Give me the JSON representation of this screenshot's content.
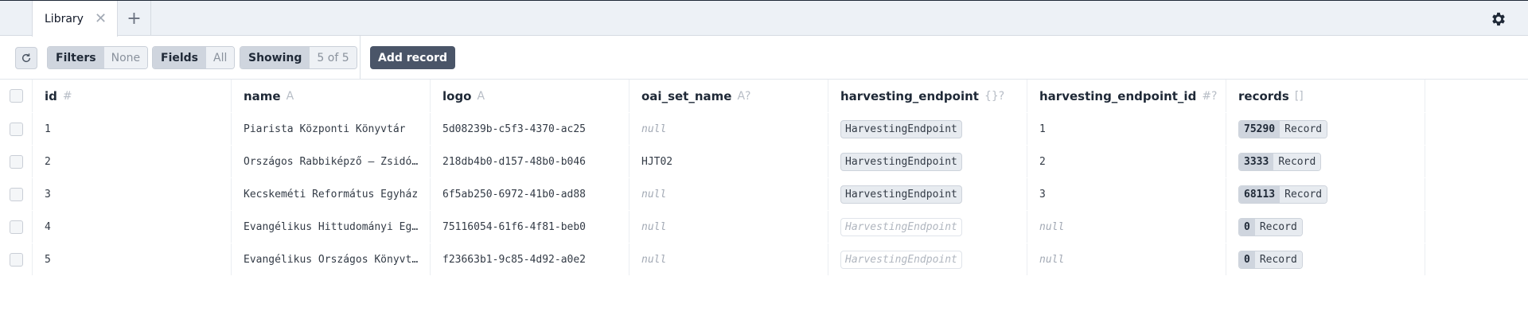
{
  "tabs": [
    {
      "label": "Library"
    }
  ],
  "toolbar": {
    "filters": {
      "label": "Filters",
      "value": "None"
    },
    "fields": {
      "label": "Fields",
      "value": "All"
    },
    "showing": {
      "label": "Showing",
      "value": "5 of 5"
    },
    "add_record": "Add record"
  },
  "table": {
    "columns": [
      {
        "name": "id",
        "type": "#"
      },
      {
        "name": "name",
        "type": "A"
      },
      {
        "name": "logo",
        "type": "A"
      },
      {
        "name": "oai_set_name",
        "type": "A?"
      },
      {
        "name": "harvesting_endpoint",
        "type": "{}?"
      },
      {
        "name": "harvesting_endpoint_id",
        "type": "#?"
      },
      {
        "name": "records",
        "type": "[]"
      }
    ],
    "rows": [
      {
        "id": "1",
        "name": "Piarista Központi Könyvtár",
        "logo": "5d08239b-c5f3-4370-ac25",
        "oai_set_name": "null",
        "harvesting_endpoint": "HarvestingEndpoint",
        "harvesting_endpoint_id": "1",
        "records_count": "75290",
        "records_label": "Record"
      },
      {
        "id": "2",
        "name": "Országos Rabbiképző – Zsidó Egyetem",
        "logo": "218db4b0-d157-48b0-b046",
        "oai_set_name": "HJT02",
        "harvesting_endpoint": "HarvestingEndpoint",
        "harvesting_endpoint_id": "2",
        "records_count": "3333",
        "records_label": "Record"
      },
      {
        "id": "3",
        "name": "Kecskeméti Református Egyház",
        "logo": "6f5ab250-6972-41b0-ad88",
        "oai_set_name": "null",
        "harvesting_endpoint": "HarvestingEndpoint",
        "harvesting_endpoint_id": "3",
        "records_count": "68113",
        "records_label": "Record"
      },
      {
        "id": "4",
        "name": "Evangélikus Hittudományi Egyetem",
        "logo": "75116054-61f6-4f81-beb0",
        "oai_set_name": "null",
        "harvesting_endpoint": "HarvestingEndpoint",
        "harvesting_endpoint_id": "null",
        "records_count": "0",
        "records_label": "Record"
      },
      {
        "id": "5",
        "name": "Evangélikus Országos Könyvtár",
        "logo": "f23663b1-9c85-4d92-a0e2",
        "oai_set_name": "null",
        "harvesting_endpoint": "HarvestingEndpoint",
        "harvesting_endpoint_id": "null",
        "records_count": "0",
        "records_label": "Record"
      }
    ]
  }
}
